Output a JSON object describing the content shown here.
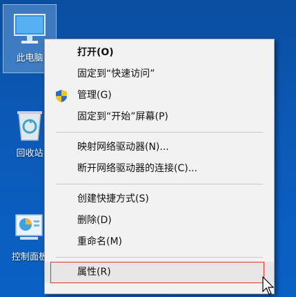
{
  "desktop": {
    "icons": [
      {
        "label": "此电脑",
        "icon": "computer-icon"
      },
      {
        "label": "回收站",
        "icon": "recycle-bin-icon"
      },
      {
        "label": "控制面板",
        "icon": "control-panel-icon"
      }
    ]
  },
  "context_menu": {
    "items": [
      {
        "label": "打开(O)",
        "bold": true
      },
      {
        "label": "固定到“快速访问”"
      },
      {
        "label": "管理(G)",
        "icon": "shield-icon"
      },
      {
        "label": "固定到“开始”屏幕(P)"
      },
      {
        "label": "映射网络驱动器(N)..."
      },
      {
        "label": "断开网络驱动器的连接(C)..."
      },
      {
        "label": "创建快捷方式(S)"
      },
      {
        "label": "删除(D)"
      },
      {
        "label": "重命名(M)"
      },
      {
        "label": "属性(R)",
        "highlighted": true
      }
    ]
  },
  "colors": {
    "desktop_background": "#0b5ab8",
    "menu_background": "#f2f2f2",
    "highlight_border": "#e03030"
  }
}
